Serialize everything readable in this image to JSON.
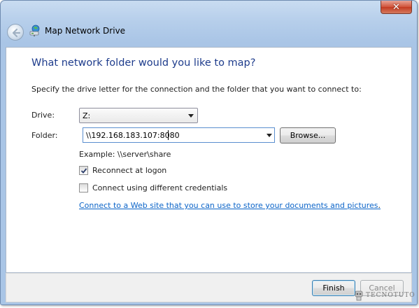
{
  "window": {
    "title": "Map Network Drive",
    "close_glyph": "✕"
  },
  "icons": {
    "back": "back-arrow-icon",
    "network_drive": "network-drive-icon"
  },
  "main": {
    "heading": "What network folder would you like to map?",
    "instruction": "Specify the drive letter for the connection and the folder that you want to connect to:",
    "drive_label": "Drive:",
    "drive_value": "Z:",
    "folder_label": "Folder:",
    "folder_value": "\\\\192.168.183.107:8080",
    "browse_label": "Browse...",
    "example": "Example: \\\\server\\share",
    "reconnect_label": "Reconnect at logon",
    "reconnect_checked": true,
    "different_credentials_label": "Connect using different credentials",
    "different_credentials_checked": false,
    "website_link": "Connect to a Web site that you can use to store your documents and pictures",
    "link_suffix": "."
  },
  "footer": {
    "finish_label": "Finish",
    "cancel_label": "Cancel"
  },
  "watermark": "TECNOTUTO",
  "colors": {
    "heading": "#1e3c8c",
    "link": "#0b64c8",
    "close_button": "#c43b22"
  }
}
